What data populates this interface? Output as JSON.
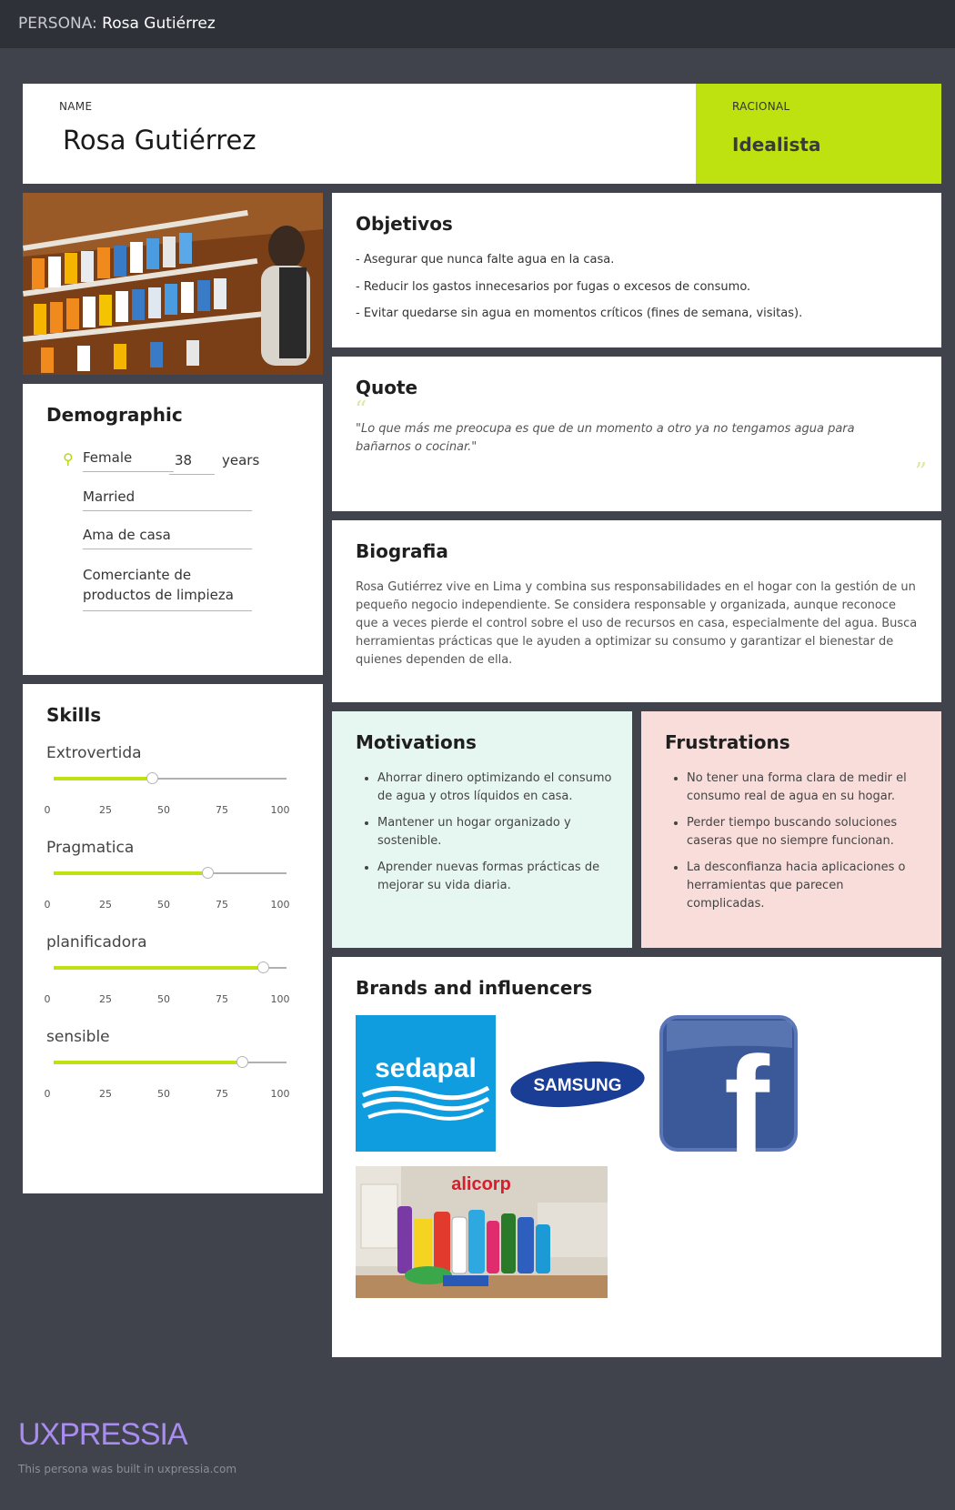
{
  "topbar": {
    "prefix": "PERSONA:",
    "name": "Rosa Gutiérrez"
  },
  "header": {
    "name_label": "NAME",
    "name_value": "Rosa Gutiérrez",
    "racional_label": "RACIONAL",
    "racional_value": "Idealista"
  },
  "demographic": {
    "title": "Demographic",
    "gender": "Female",
    "age": "38",
    "age_unit": "years",
    "status": "Married",
    "role": "Ama de casa",
    "occupation_line1": "Comerciante de",
    "occupation_line2": "productos de limpieza"
  },
  "skills": {
    "title": "Skills",
    "ticks": [
      "0",
      "25",
      "50",
      "75",
      "100"
    ],
    "items": [
      {
        "name": "Extrovertida",
        "value": 42
      },
      {
        "name": "Pragmatica",
        "value": 66
      },
      {
        "name": "planificadora",
        "value": 90
      },
      {
        "name": "sensible",
        "value": 81
      }
    ]
  },
  "objetivos": {
    "title": "Objetivos",
    "lines": [
      " - Asegurar que nunca falte agua en la casa.",
      "- Reducir los gastos innecesarios por fugas o excesos de consumo.",
      "- Evitar quedarse sin agua en momentos críticos (fines de semana, visitas)."
    ]
  },
  "quote": {
    "title": "Quote",
    "text": "\"Lo que más me preocupa es que de un momento a otro ya no tengamos agua para bañarnos o cocinar.\""
  },
  "biografia": {
    "title": "Biografia",
    "text": "Rosa Gutiérrez vive en Lima y combina sus responsabilidades en el hogar con la gestión de un pequeño negocio independiente. Se considera responsable y organizada, aunque reconoce que a veces pierde el control sobre el uso de recursos en casa, especialmente del agua. Busca herramientas prácticas que le ayuden a optimizar su consumo y garantizar el bienestar de quienes dependen de ella."
  },
  "motivations": {
    "title": "Motivations",
    "items": [
      "Ahorrar dinero optimizando el consumo de agua y otros líquidos en casa.",
      "Mantener un hogar organizado y sostenible.",
      "Aprender nuevas formas prácticas de mejorar su vida diaria."
    ]
  },
  "frustrations": {
    "title": "Frustrations",
    "items": [
      "No tener una forma clara de medir el consumo real de agua en su hogar.",
      "Perder tiempo buscando soluciones caseras que no siempre funcionan.",
      "La desconfianza hacia aplicaciones o herramientas que parecen complicadas."
    ]
  },
  "brands": {
    "title": "Brands and influencers",
    "sedapal": "sedapal",
    "samsung": "SAMSUNG",
    "facebook": "f",
    "alicorp": "alicorp"
  },
  "footer": {
    "logo": "UXPRESSIA",
    "text": "This persona was built in uxpressia.com"
  },
  "colors": {
    "accent": "#bde20f",
    "background": "#40434c",
    "motivations_bg": "#e6f6f1",
    "frustrations_bg": "#f8ddda"
  }
}
